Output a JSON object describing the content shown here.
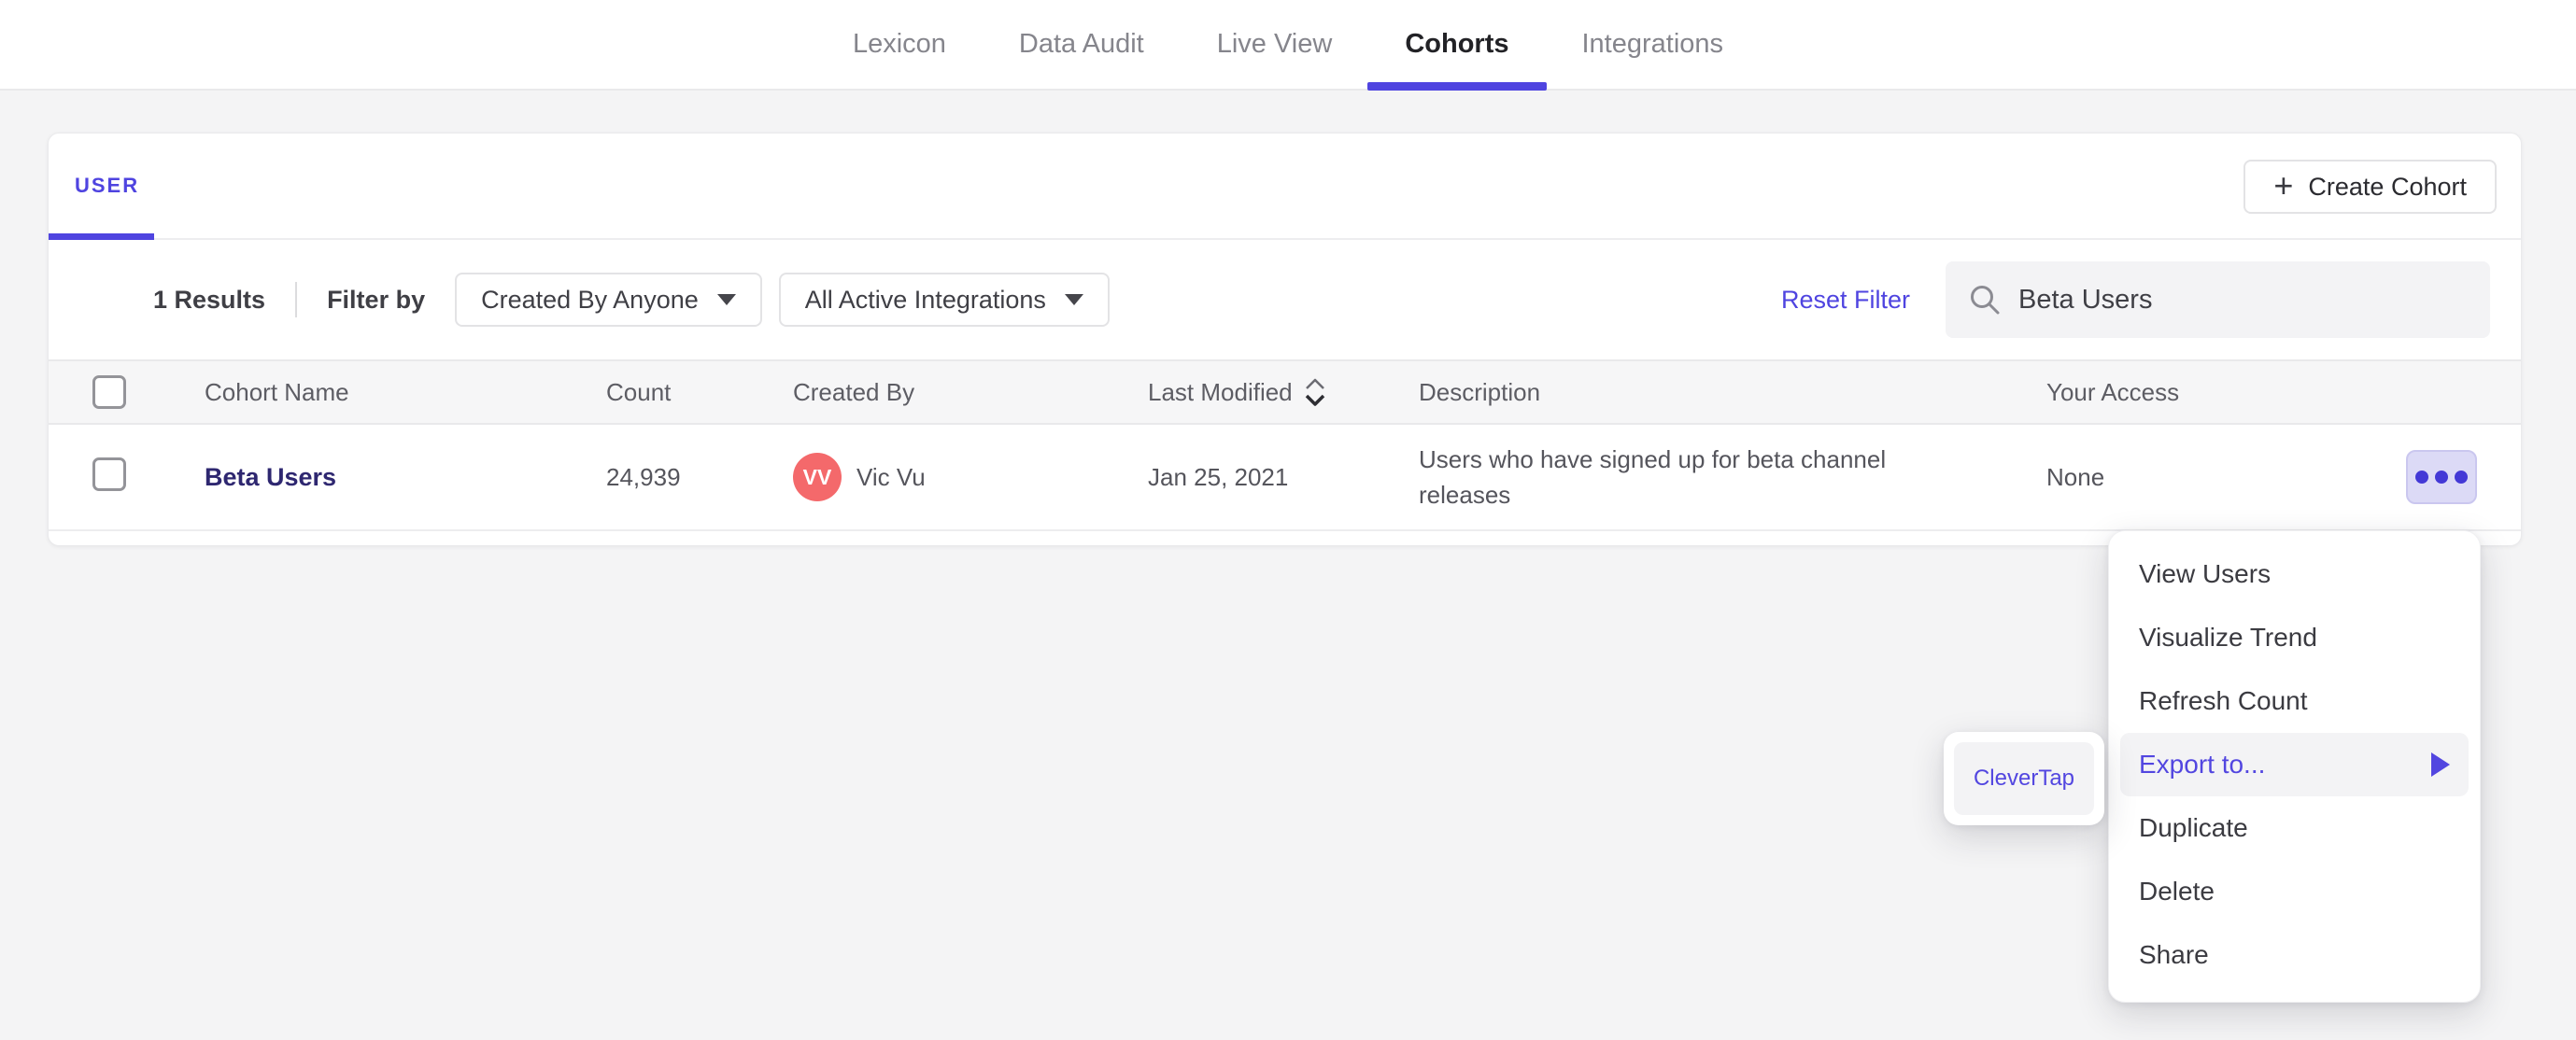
{
  "colors": {
    "accent": "#4f44e0",
    "menu_accent": "#5246e0",
    "avatar_bg": "#f4696b",
    "cohort_link": "#2e2770",
    "page_bg": "#f4f4f5",
    "table_header_bg": "#f6f6f7",
    "more_button_bg": "#dcdaf6",
    "highlight_bg": "#f3f3f5"
  },
  "icons": {
    "search": "magnifier-glyph",
    "sort": "up-down-chevrons",
    "plus": "+",
    "more": "three-outlined-circles",
    "dropdown_caret": "solid-down-triangle",
    "submenu_arrow": "solid-right-triangle"
  },
  "nav": {
    "tabs": [
      {
        "label": "Lexicon",
        "active": false
      },
      {
        "label": "Data Audit",
        "active": false
      },
      {
        "label": "Live View",
        "active": false
      },
      {
        "label": "Cohorts",
        "active": true
      },
      {
        "label": "Integrations",
        "active": false
      }
    ]
  },
  "card": {
    "user_tab_label": "USER",
    "create_button": {
      "plus": "+",
      "label": "Create Cohort"
    },
    "filter_bar": {
      "results_count": "1 Results",
      "filter_by_label": "Filter by",
      "created_by_dropdown": "Created By Anyone",
      "integrations_dropdown": "All Active Integrations",
      "reset_filter": "Reset Filter",
      "search_value": "Beta Users"
    },
    "table": {
      "headers": {
        "cohort_name": "Cohort Name",
        "count": "Count",
        "created_by": "Created By",
        "last_modified": "Last Modified",
        "description": "Description",
        "your_access": "Your Access"
      },
      "row": {
        "name": "Beta Users",
        "count": "24,939",
        "created_by_initials": "VV",
        "created_by_name": "Vic Vu",
        "last_modified": "Jan 25, 2021",
        "description": "Users who have signed up for beta channel releases",
        "access": "None"
      }
    }
  },
  "context_menu": {
    "items": [
      "View Users",
      "Visualize Trend",
      "Refresh Count",
      "Export to...",
      "Duplicate",
      "Delete",
      "Share"
    ],
    "highlighted_item": "Export to..."
  },
  "submenu": {
    "items": [
      "CleverTap"
    ]
  }
}
